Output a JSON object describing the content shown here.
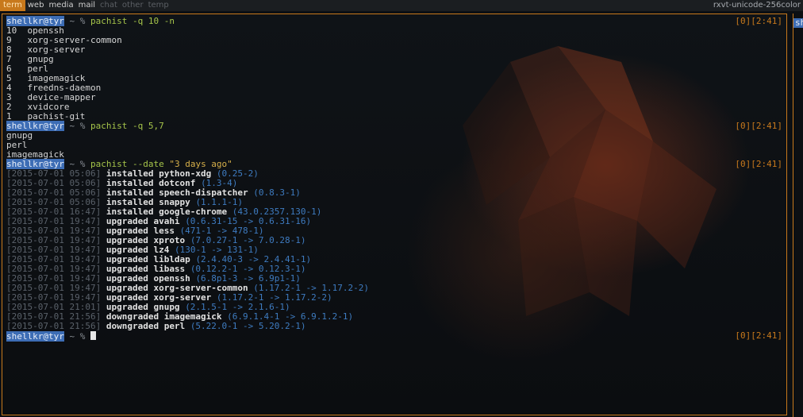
{
  "topbar": {
    "tags": [
      {
        "label": "term",
        "state": "active"
      },
      {
        "label": "web",
        "state": "normal"
      },
      {
        "label": "media",
        "state": "normal"
      },
      {
        "label": "mail",
        "state": "normal"
      },
      {
        "label": "chat",
        "state": "dim"
      },
      {
        "label": "other",
        "state": "dim"
      },
      {
        "label": "temp",
        "state": "dim"
      }
    ],
    "window_title": "rxvt-unicode-256color"
  },
  "prompt": {
    "user": "shellkr@tyr",
    "tilde": "~",
    "symbol": "%"
  },
  "status": "[0][2:41]",
  "side_pane_label": "sh",
  "blocks": [
    {
      "command": "pachist -q 10 -n",
      "output": [
        "10  openssh",
        "9   xorg-server-common",
        "8   xorg-server",
        "7   gnupg",
        "6   perl",
        "5   imagemagick",
        "4   freedns-daemon",
        "3   device-mapper",
        "2   xvidcore",
        "1   pachist-git"
      ]
    },
    {
      "command": "pachist -q 5,7",
      "output": [
        "gnupg",
        "perl",
        "imagemagick"
      ]
    },
    {
      "command": "pachist --date",
      "command_arg": "\"3 days ago\"",
      "entries": [
        {
          "ts": "[2015-07-01 05:06]",
          "action": "installed python-xdg",
          "ver": "(0.25-2)"
        },
        {
          "ts": "[2015-07-01 05:06]",
          "action": "installed dotconf",
          "ver": "(1.3-4)"
        },
        {
          "ts": "[2015-07-01 05:06]",
          "action": "installed speech-dispatcher",
          "ver": "(0.8.3-1)"
        },
        {
          "ts": "[2015-07-01 05:06]",
          "action": "installed snappy",
          "ver": "(1.1.1-1)"
        },
        {
          "ts": "[2015-07-01 16:47]",
          "action": "installed google-chrome",
          "ver": "(43.0.2357.130-1)"
        },
        {
          "ts": "[2015-07-01 19:47]",
          "action": "upgraded avahi",
          "ver": "(0.6.31-15 -> 0.6.31-16)"
        },
        {
          "ts": "[2015-07-01 19:47]",
          "action": "upgraded less",
          "ver": "(471-1 -> 478-1)"
        },
        {
          "ts": "[2015-07-01 19:47]",
          "action": "upgraded xproto",
          "ver": "(7.0.27-1 -> 7.0.28-1)"
        },
        {
          "ts": "[2015-07-01 19:47]",
          "action": "upgraded lz4",
          "ver": "(130-1 -> 131-1)"
        },
        {
          "ts": "[2015-07-01 19:47]",
          "action": "upgraded libldap",
          "ver": "(2.4.40-3 -> 2.4.41-1)"
        },
        {
          "ts": "[2015-07-01 19:47]",
          "action": "upgraded libass",
          "ver": "(0.12.2-1 -> 0.12.3-1)"
        },
        {
          "ts": "[2015-07-01 19:47]",
          "action": "upgraded openssh",
          "ver": "(6.8p1-3 -> 6.9p1-1)"
        },
        {
          "ts": "[2015-07-01 19:47]",
          "action": "upgraded xorg-server-common",
          "ver": "(1.17.2-1 -> 1.17.2-2)"
        },
        {
          "ts": "[2015-07-01 19:47]",
          "action": "upgraded xorg-server",
          "ver": "(1.17.2-1 -> 1.17.2-2)"
        },
        {
          "ts": "[2015-07-01 21:01]",
          "action": "upgraded gnupg",
          "ver": "(2.1.5-1 -> 2.1.6-1)"
        },
        {
          "ts": "[2015-07-01 21:56]",
          "action": "downgraded imagemagick",
          "ver": "(6.9.1.4-1 -> 6.9.1.2-1)"
        },
        {
          "ts": "[2015-07-01 21:56]",
          "action": "downgraded perl",
          "ver": "(5.22.0-1 -> 5.20.2-1)"
        }
      ]
    }
  ],
  "colors": {
    "accent": "#c8791c",
    "prompt_bg": "#3d6db5",
    "command": "#a6c54a",
    "version": "#3e7bc0",
    "string": "#d7b04a"
  }
}
